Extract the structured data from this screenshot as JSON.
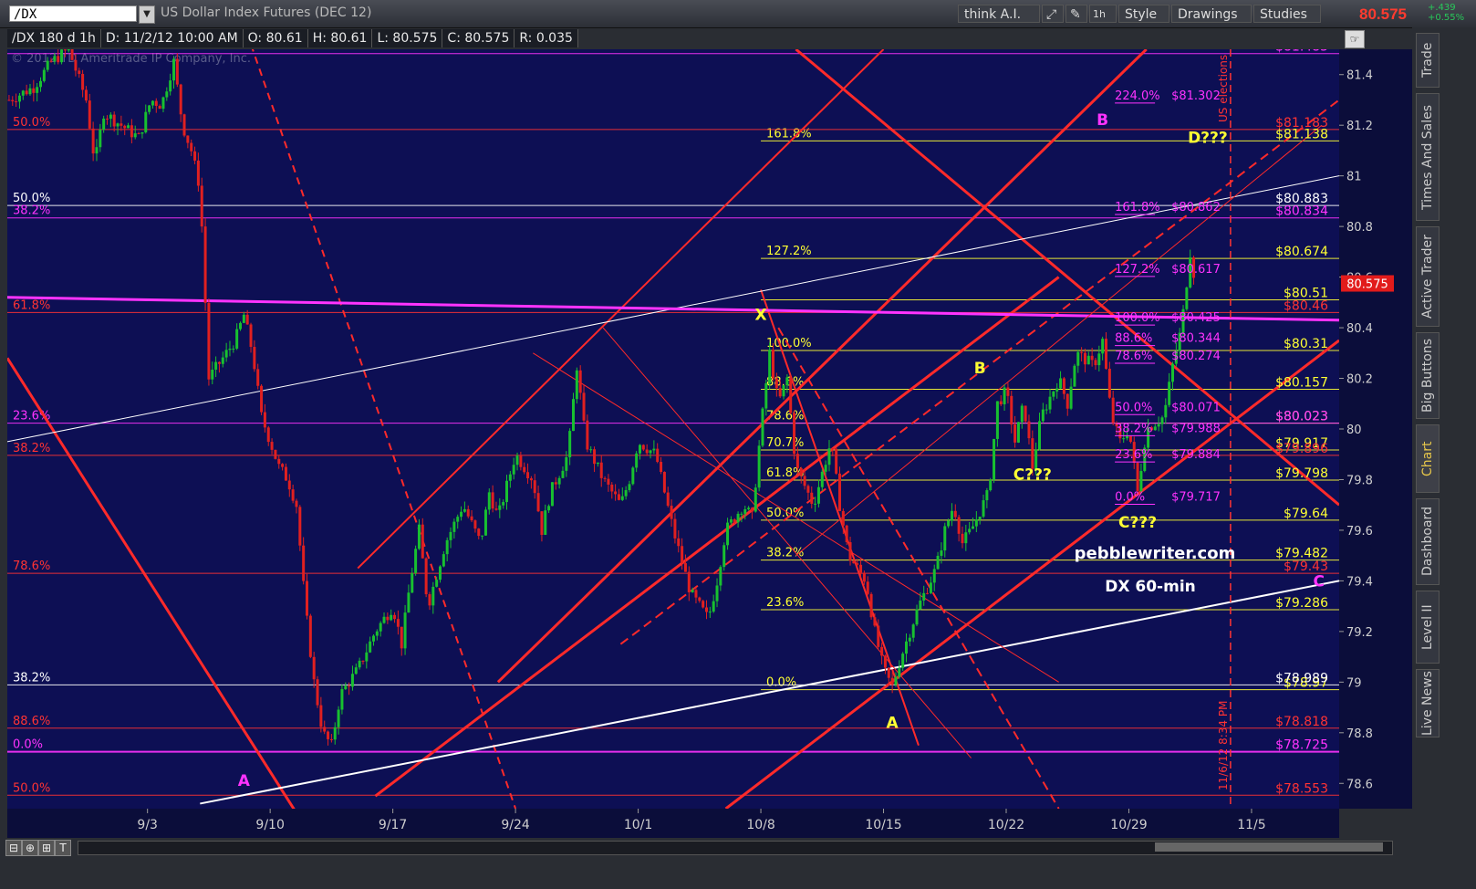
{
  "header": {
    "symbol": "/DX",
    "title": "US Dollar Index Futures (DEC 12)",
    "think_ai": "think A.I.",
    "interval": "1h",
    "style": "Style",
    "drawings": "Drawings",
    "studies": "Studies",
    "last_price": "80.575",
    "change": "+.439",
    "change_pct": "+0.55%"
  },
  "infobar": {
    "chart_id": "/DX 180 d 1h",
    "date": "D: 11/2/12 10:00 AM",
    "open": "O: 80.61",
    "high": "H: 80.61",
    "low": "L: 80.575",
    "close": "C: 80.575",
    "range": "R: 0.035"
  },
  "sidebar": {
    "tabs": [
      "Trade",
      "Times And Sales",
      "Active Trader",
      "Big Buttons",
      "Chart",
      "Dashboard",
      "Level II",
      "Live News"
    ],
    "active": "Chart"
  },
  "colors": {
    "background": "#0d0f54",
    "candle_up": "#18c030",
    "candle_down": "#e02020",
    "channel": "#ff2a2a",
    "fib_yellow": "#ffff33",
    "fib_magenta": "#ff33ff",
    "fib_red": "#ff3333",
    "white": "#ffffff"
  },
  "chart_data": {
    "type": "candlestick",
    "title": "DX 60-min",
    "watermark": "pebblewriter.com",
    "copyright": "© 2012 TD Ameritrade IP Company, Inc.",
    "ylim": [
      78.5,
      81.5
    ],
    "y_ticks": [
      "81.4",
      "81.2",
      "81",
      "80.8",
      "80.6",
      "80.4",
      "80.2",
      "80",
      "79.8",
      "79.6",
      "79.4",
      "79.2",
      "79",
      "78.8",
      "78.6"
    ],
    "x_ticks": [
      "9/3",
      "9/10",
      "9/17",
      "9/24",
      "10/1",
      "10/8",
      "10/15",
      "10/22",
      "10/29",
      "11/5"
    ],
    "x_tick_positions": [
      3,
      10,
      17,
      24,
      31,
      38,
      45,
      52,
      59,
      66
    ],
    "x_range": [
      -5,
      71
    ],
    "current_price": "80.575",
    "price_path": [
      [
        -4.9,
        81.3
      ],
      [
        -3.5,
        81.35
      ],
      [
        -2.5,
        81.45
      ],
      [
        -1.5,
        81.5
      ],
      [
        -0.5,
        81.3
      ],
      [
        0.0,
        81.05
      ],
      [
        0.5,
        81.25
      ],
      [
        1.5,
        81.2
      ],
      [
        2.5,
        81.15
      ],
      [
        3.2,
        81.3
      ],
      [
        3.8,
        81.28
      ],
      [
        4.5,
        81.45
      ],
      [
        5.0,
        81.2
      ],
      [
        5.5,
        81.1
      ],
      [
        6.0,
        80.95
      ],
      [
        6.5,
        80.2
      ],
      [
        7.0,
        80.25
      ],
      [
        7.5,
        80.3
      ],
      [
        8.0,
        80.35
      ],
      [
        8.5,
        80.45
      ],
      [
        9.0,
        80.3
      ],
      [
        9.5,
        80.05
      ],
      [
        10.0,
        79.95
      ],
      [
        10.5,
        79.85
      ],
      [
        11.0,
        79.8
      ],
      [
        11.5,
        79.7
      ],
      [
        12.0,
        79.3
      ],
      [
        12.5,
        79.0
      ],
      [
        13.0,
        78.8
      ],
      [
        13.5,
        78.75
      ],
      [
        14.0,
        78.95
      ],
      [
        15.0,
        79.05
      ],
      [
        16.0,
        79.2
      ],
      [
        17.0,
        79.3
      ],
      [
        17.5,
        79.15
      ],
      [
        18.0,
        79.4
      ],
      [
        18.5,
        79.6
      ],
      [
        19.0,
        79.3
      ],
      [
        20.0,
        79.55
      ],
      [
        21.0,
        79.7
      ],
      [
        22.0,
        79.55
      ],
      [
        22.5,
        79.75
      ],
      [
        23.0,
        79.65
      ],
      [
        24.0,
        79.9
      ],
      [
        25.0,
        79.8
      ],
      [
        25.5,
        79.6
      ],
      [
        26.0,
        79.75
      ],
      [
        27.0,
        79.9
      ],
      [
        27.5,
        80.25
      ],
      [
        28.0,
        79.95
      ],
      [
        29.0,
        79.8
      ],
      [
        30.0,
        79.7
      ],
      [
        30.5,
        79.8
      ],
      [
        31.0,
        79.95
      ],
      [
        32.0,
        79.9
      ],
      [
        33.0,
        79.6
      ],
      [
        34.0,
        79.35
      ],
      [
        35.0,
        79.25
      ],
      [
        35.5,
        79.4
      ],
      [
        36.0,
        79.6
      ],
      [
        37.0,
        79.7
      ],
      [
        37.5,
        79.65
      ],
      [
        38.0,
        80.0
      ],
      [
        38.5,
        80.3
      ],
      [
        39.0,
        80.1
      ],
      [
        39.5,
        80.2
      ],
      [
        40.0,
        79.85
      ],
      [
        41.0,
        79.7
      ],
      [
        42.0,
        79.95
      ],
      [
        42.5,
        79.7
      ],
      [
        43.0,
        79.5
      ],
      [
        44.0,
        79.4
      ],
      [
        44.5,
        79.2
      ],
      [
        45.0,
        79.05
      ],
      [
        45.5,
        78.98
      ],
      [
        46.0,
        79.1
      ],
      [
        47.0,
        79.3
      ],
      [
        48.0,
        79.45
      ],
      [
        48.5,
        79.6
      ],
      [
        49.0,
        79.7
      ],
      [
        49.5,
        79.55
      ],
      [
        50.0,
        79.6
      ],
      [
        51.0,
        79.75
      ],
      [
        51.5,
        80.1
      ],
      [
        52.0,
        80.15
      ],
      [
        52.5,
        79.95
      ],
      [
        53.0,
        80.1
      ],
      [
        53.5,
        79.85
      ],
      [
        54.0,
        80.05
      ],
      [
        55.0,
        80.2
      ],
      [
        55.5,
        80.1
      ],
      [
        56.0,
        80.3
      ],
      [
        57.0,
        80.25
      ],
      [
        57.5,
        80.35
      ],
      [
        58.0,
        80.05
      ],
      [
        58.5,
        79.95
      ],
      [
        59.0,
        80.0
      ],
      [
        59.5,
        79.75
      ],
      [
        60.0,
        80.0
      ],
      [
        61.0,
        80.05
      ],
      [
        61.5,
        80.25
      ],
      [
        62.0,
        80.4
      ],
      [
        62.5,
        80.7
      ],
      [
        62.8,
        80.575
      ]
    ],
    "horizontal_levels": [
      {
        "price": 81.138,
        "color": "#ffff33",
        "left_label": "161.8%",
        "right_label": "$81.138"
      },
      {
        "price": 80.674,
        "color": "#ffff33",
        "left_label": "127.2%",
        "right_label": "$80.674"
      },
      {
        "price": 80.51,
        "color": "#ffff33",
        "left_label": "",
        "right_label": "$80.51"
      },
      {
        "price": 80.31,
        "color": "#ffff33",
        "left_label": "100.0%",
        "right_label": "$80.31"
      },
      {
        "price": 80.157,
        "color": "#ffff33",
        "left_label": "88.6%",
        "right_label": "$80.157"
      },
      {
        "price": 80.023,
        "color": "#ffff33",
        "left_label": "78.6%",
        "right_label": "$80.023"
      },
      {
        "price": 79.917,
        "color": "#ffff33",
        "left_label": "70.7%",
        "right_label": "$79.917"
      },
      {
        "price": 79.798,
        "color": "#ffff33",
        "left_label": "61.8%",
        "right_label": "$79.798"
      },
      {
        "price": 79.64,
        "color": "#ffff33",
        "left_label": "50.0%",
        "right_label": "$79.64"
      },
      {
        "price": 79.482,
        "color": "#ffff33",
        "left_label": "38.2%",
        "right_label": "$79.482"
      },
      {
        "price": 79.286,
        "color": "#ffff33",
        "left_label": "23.6%",
        "right_label": "$79.286"
      },
      {
        "price": 78.97,
        "color": "#ffff33",
        "left_label": "0.0%",
        "right_label": "$78.97"
      },
      {
        "price": 80.883,
        "color": "#ffffff",
        "left_label": "50.0%",
        "right_label": "$80.883"
      },
      {
        "price": 78.989,
        "color": "#ffffff",
        "left_label": "38.2%",
        "right_label": "$78.989"
      },
      {
        "price": 80.834,
        "color": "#ff33ff",
        "left_label": "38.2%",
        "right_label": "$80.834"
      },
      {
        "price": 80.023,
        "color": "#ff33ff",
        "left_label": "23.6%",
        "right_label": "$80.023"
      },
      {
        "price": 78.725,
        "color": "#ff33ff",
        "left_label": "0.0%",
        "right_label": "$78.725"
      },
      {
        "price": 81.483,
        "color": "#ff33ff",
        "left_label": "",
        "right_label": "$81.483"
      },
      {
        "price": 81.183,
        "color": "#ff3333",
        "left_label": "50.0%",
        "right_label": "$81.183"
      },
      {
        "price": 80.46,
        "color": "#ff3333",
        "left_label": "61.8%",
        "right_label": "$80.46"
      },
      {
        "price": 79.896,
        "color": "#ff3333",
        "left_label": "38.2%",
        "right_label": "$79.896"
      },
      {
        "price": 79.43,
        "color": "#ff3333",
        "left_label": "78.6%",
        "right_label": "$79.43"
      },
      {
        "price": 78.818,
        "color": "#ff3333",
        "left_label": "88.6%",
        "right_label": "$78.818"
      },
      {
        "price": 78.553,
        "color": "#ff3333",
        "left_label": "50.0%",
        "right_label": "$78.553"
      }
    ],
    "magenta_fib_labels": [
      {
        "pct": "224.0%",
        "price": "$81.302",
        "value": 81.302
      },
      {
        "pct": "161.8%",
        "price": "$80.862",
        "value": 80.862
      },
      {
        "pct": "127.2%",
        "price": "$80.617",
        "value": 80.617
      },
      {
        "pct": "100.0%",
        "price": "$80.425",
        "value": 80.425
      },
      {
        "pct": "88.6%",
        "price": "$80.344",
        "value": 80.344
      },
      {
        "pct": "78.6%",
        "price": "$80.274",
        "value": 80.274
      },
      {
        "pct": "50.0%",
        "price": "$80.071",
        "value": 80.071
      },
      {
        "pct": "38.2%",
        "price": "$79.988",
        "value": 79.988
      },
      {
        "pct": "23.6%",
        "price": "$79.884",
        "value": 79.884
      },
      {
        "pct": "0.0%",
        "price": "$79.717",
        "value": 79.717
      }
    ],
    "wave_labels": [
      {
        "text": "A",
        "x": 8.5,
        "y": 78.59,
        "color": "#ff33ff"
      },
      {
        "text": "X",
        "x": 38.0,
        "y": 80.43,
        "color": "#ffff33"
      },
      {
        "text": "A",
        "x": 45.5,
        "y": 78.82,
        "color": "#ffff33"
      },
      {
        "text": "B",
        "x": 50.5,
        "y": 80.22,
        "color": "#ffff33"
      },
      {
        "text": "B",
        "x": 57.5,
        "y": 81.2,
        "color": "#ff33ff"
      },
      {
        "text": "C???",
        "x": 53.5,
        "y": 79.8,
        "color": "#ffff33"
      },
      {
        "text": "C???",
        "x": 59.5,
        "y": 79.61,
        "color": "#ffff33"
      },
      {
        "text": "D???",
        "x": 63.5,
        "y": 81.13,
        "color": "#ffff33"
      }
    ],
    "vertical_marker": {
      "x": 64.8,
      "label": "11/6/12 8:34 PM",
      "note": "US elections"
    },
    "right_marker": "C"
  }
}
